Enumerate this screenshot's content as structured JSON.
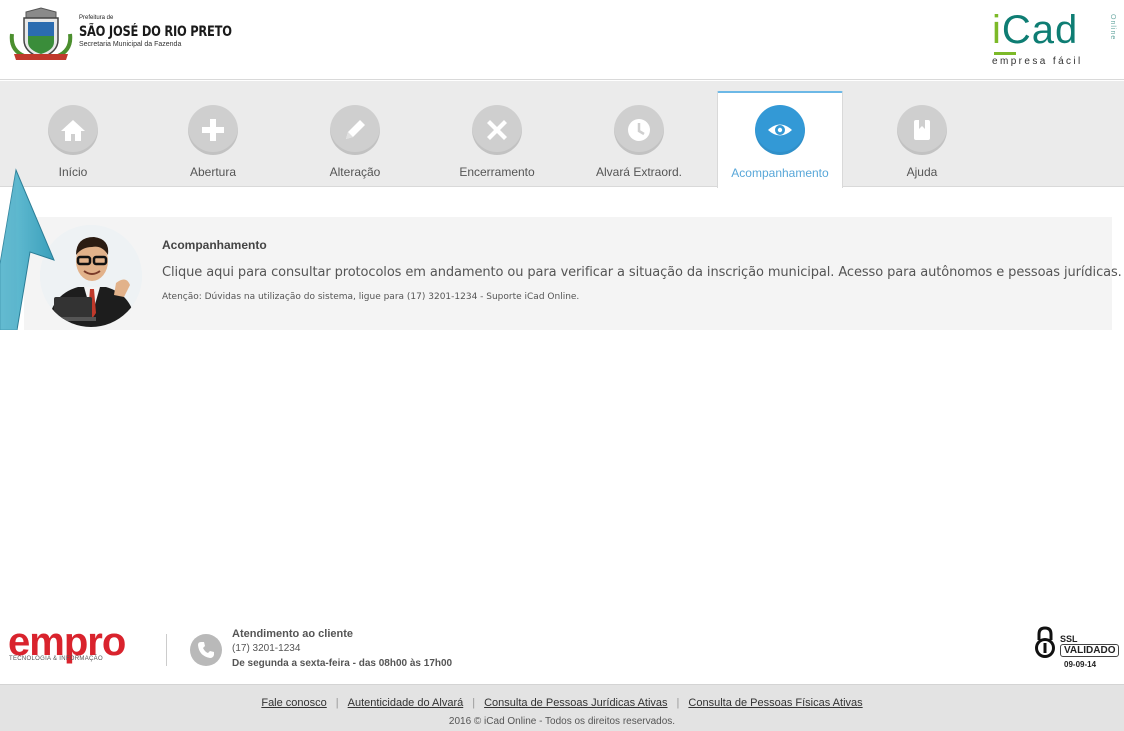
{
  "header": {
    "prefeitura_label": "Prefeitura de",
    "city": "SÃO JOSÉ DO RIO PRETO",
    "secretaria": "Secretaria Municipal da Fazenda",
    "brand": {
      "i": "i",
      "word": "Cad",
      "tagline": "empresa fácil",
      "online": "Online"
    }
  },
  "nav": {
    "items": [
      {
        "label": "Início",
        "icon": "home-icon"
      },
      {
        "label": "Abertura",
        "icon": "plus-icon"
      },
      {
        "label": "Alteração",
        "icon": "pencil-icon"
      },
      {
        "label": "Encerramento",
        "icon": "close-icon"
      },
      {
        "label": "Alvará Extraord.",
        "icon": "clock-icon"
      },
      {
        "label": "Acompanhamento",
        "icon": "eye-icon",
        "active": true
      },
      {
        "label": "Ajuda",
        "icon": "book-icon"
      }
    ],
    "active_color": "#3399d6"
  },
  "content": {
    "title": "Acompanhamento",
    "description": "Clique aqui para consultar protocolos em andamento ou para verificar a situação da inscrição municipal. Acesso para autônomos e pessoas jurídicas.",
    "note": "Atenção: Dúvidas na utilização do sistema, ligue para (17) 3201-1234 - Suporte iCad Online."
  },
  "footer": {
    "empro": {
      "word": "empro",
      "tagline": "TECNOLOGIA & INFORMAÇÃO"
    },
    "contact": {
      "title": "Atendimento ao cliente",
      "phone": "(17) 3201-1234",
      "hours": "De segunda a sexta-feira - das 08h00 às 17h00"
    },
    "ssl": {
      "line1": "SSL",
      "line2": "VALIDADO",
      "date": "09-09-14"
    },
    "links": [
      "Fale conosco",
      "Autenticidade do Alvará",
      "Consulta de Pessoas Jurídicas Ativas",
      "Consulta de Pessoas Físicas Ativas"
    ],
    "copyright": "2016 © iCad Online - Todos os direitos reservados."
  },
  "colors": {
    "brand_green": "#0e7d73",
    "accent_blue": "#3399d6",
    "empro_red": "#d9232d"
  }
}
